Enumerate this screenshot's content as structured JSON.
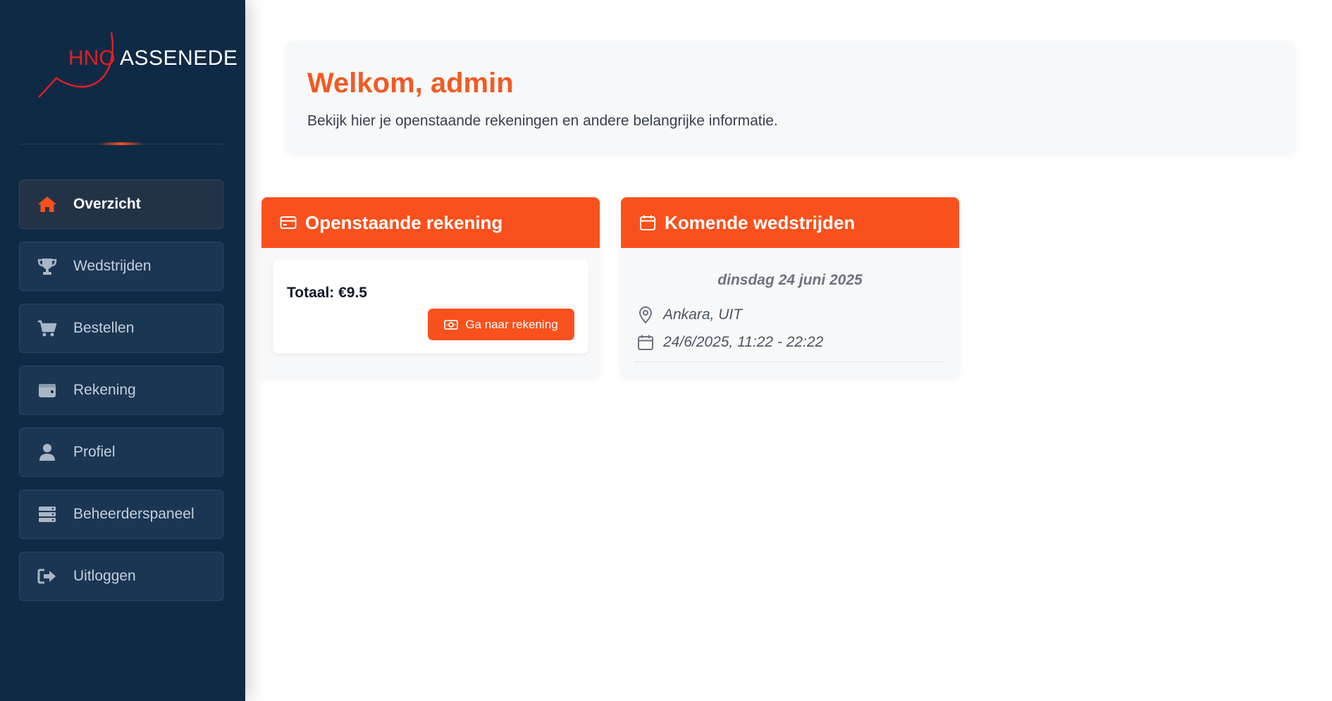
{
  "brand": {
    "logo_prefix": "HNO",
    "logo_name": "ASSENEDE",
    "accent": "#f9511d",
    "logo_red": "#e31e24",
    "sidebar_bg": "#0f2a45"
  },
  "sidebar": {
    "items": [
      {
        "label": "Overzicht",
        "icon": "home-icon",
        "active": true
      },
      {
        "label": "Wedstrijden",
        "icon": "trophy-icon",
        "active": false
      },
      {
        "label": "Bestellen",
        "icon": "cart-icon",
        "active": false
      },
      {
        "label": "Rekening",
        "icon": "wallet-icon",
        "active": false
      },
      {
        "label": "Profiel",
        "icon": "user-icon",
        "active": false
      },
      {
        "label": "Beheerderspaneel",
        "icon": "server-icon",
        "active": false
      },
      {
        "label": "Uitloggen",
        "icon": "logout-icon",
        "active": false
      }
    ]
  },
  "welcome": {
    "title": "Welkom, admin",
    "subtitle": "Bekijk hier je openstaande rekeningen en andere belangrijke informatie."
  },
  "invoice_card": {
    "title": "Openstaande rekening",
    "icon": "credit-card-icon",
    "total": "Totaal: €9.5",
    "button_label": "Ga naar rekening",
    "button_icon": "money-icon"
  },
  "matches_card": {
    "title": "Komende wedstrijden",
    "icon": "calendar-icon",
    "match": {
      "date_heading": "dinsdag 24 juni 2025",
      "location": "Ankara,  UIT",
      "datetime": "24/6/2025,  11:22  -  22:22"
    }
  }
}
